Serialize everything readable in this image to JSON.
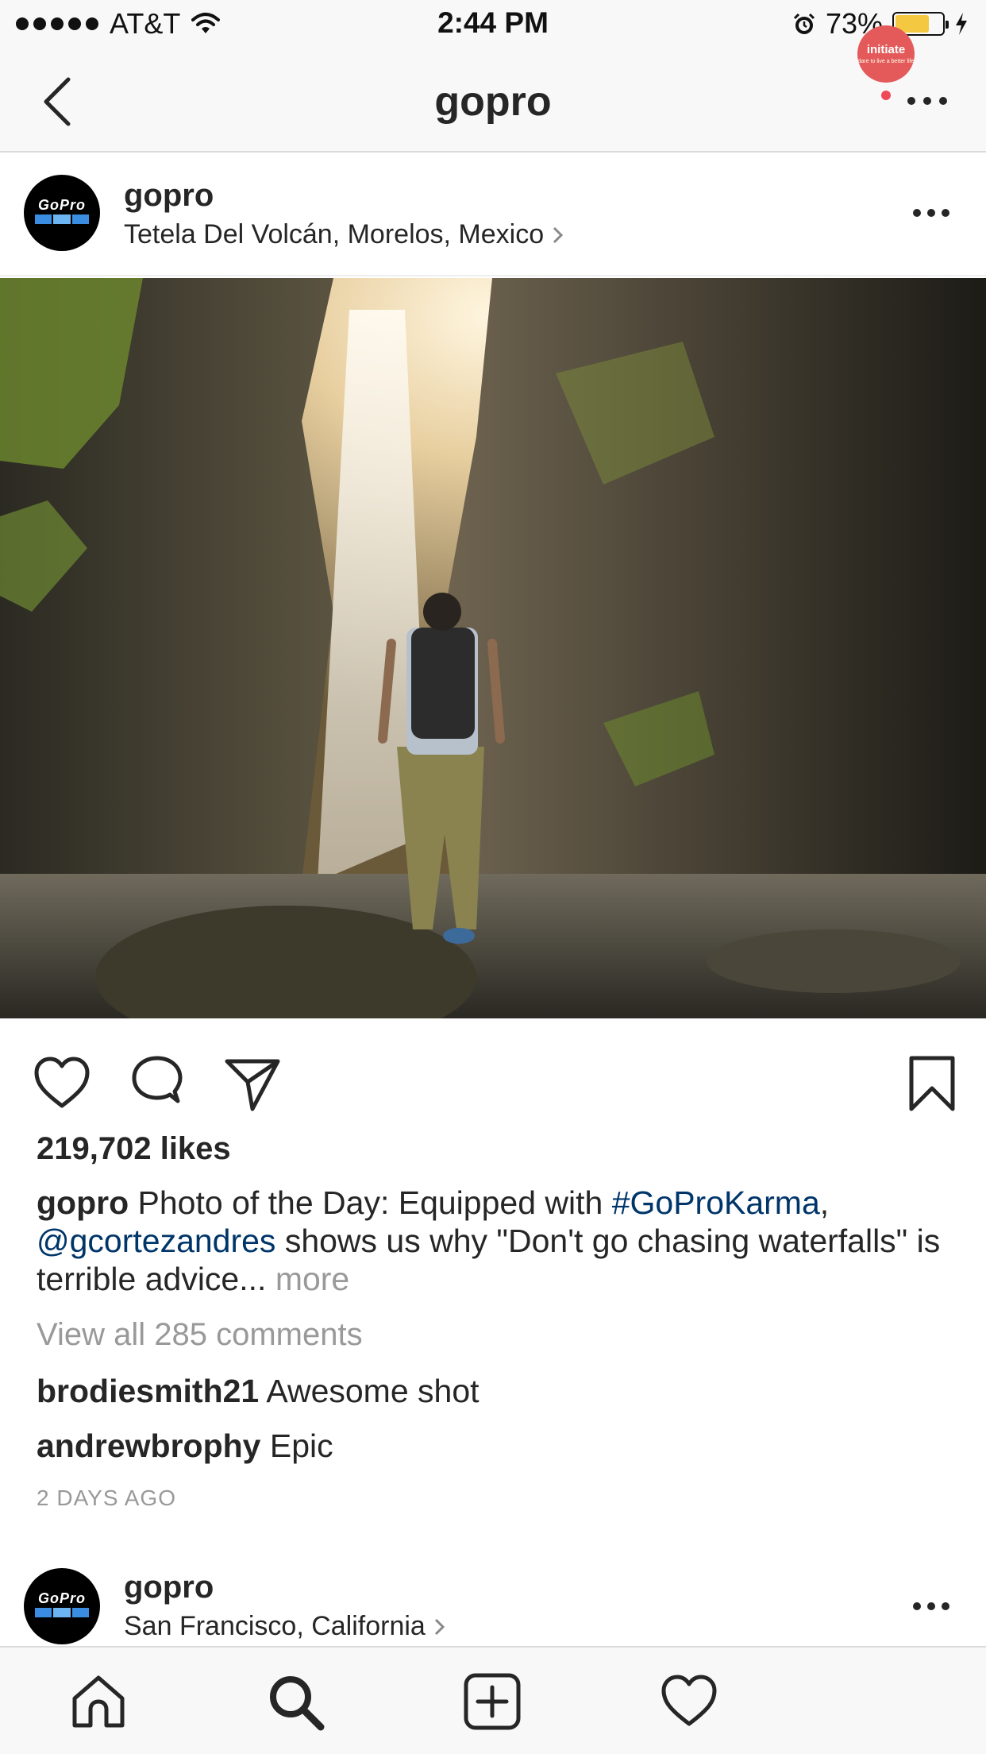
{
  "status_bar": {
    "carrier": "AT&T",
    "time": "2:44 PM",
    "battery_percent": "73%"
  },
  "nav": {
    "title": "gopro"
  },
  "post": {
    "username": "gopro",
    "avatar_logo_text": "GoPro",
    "location": "Tetela Del Volcán, Morelos, Mexico",
    "likes": "219,702 likes",
    "caption": {
      "username": "gopro",
      "text_1": " Photo of the Day: Equipped with ",
      "hashtag": "#GoProKarma",
      "text_2": ",",
      "mention": "@gcortezandres",
      "text_3": " shows us why \"Don't go chasing waterfalls\" is terrible advice",
      "ellipsis": "... ",
      "more": "more"
    },
    "view_all_comments": "View all 285 comments",
    "comments": [
      {
        "username": "brodiesmith21",
        "text": " Awesome shot"
      },
      {
        "username": "andrewbrophy",
        "text": " Epic"
      }
    ],
    "timestamp": "2 DAYS AGO"
  },
  "next_post": {
    "username": "gopro",
    "avatar_logo_text": "GoPro",
    "location": "San Francisco, California"
  },
  "tab_bar": {
    "profile_text": "initiate",
    "profile_tag": "dare to live a better life"
  },
  "colors": {
    "link": "#003569",
    "muted": "#999999",
    "battery": "#f5c842",
    "notification_dot": "#ed4956"
  }
}
